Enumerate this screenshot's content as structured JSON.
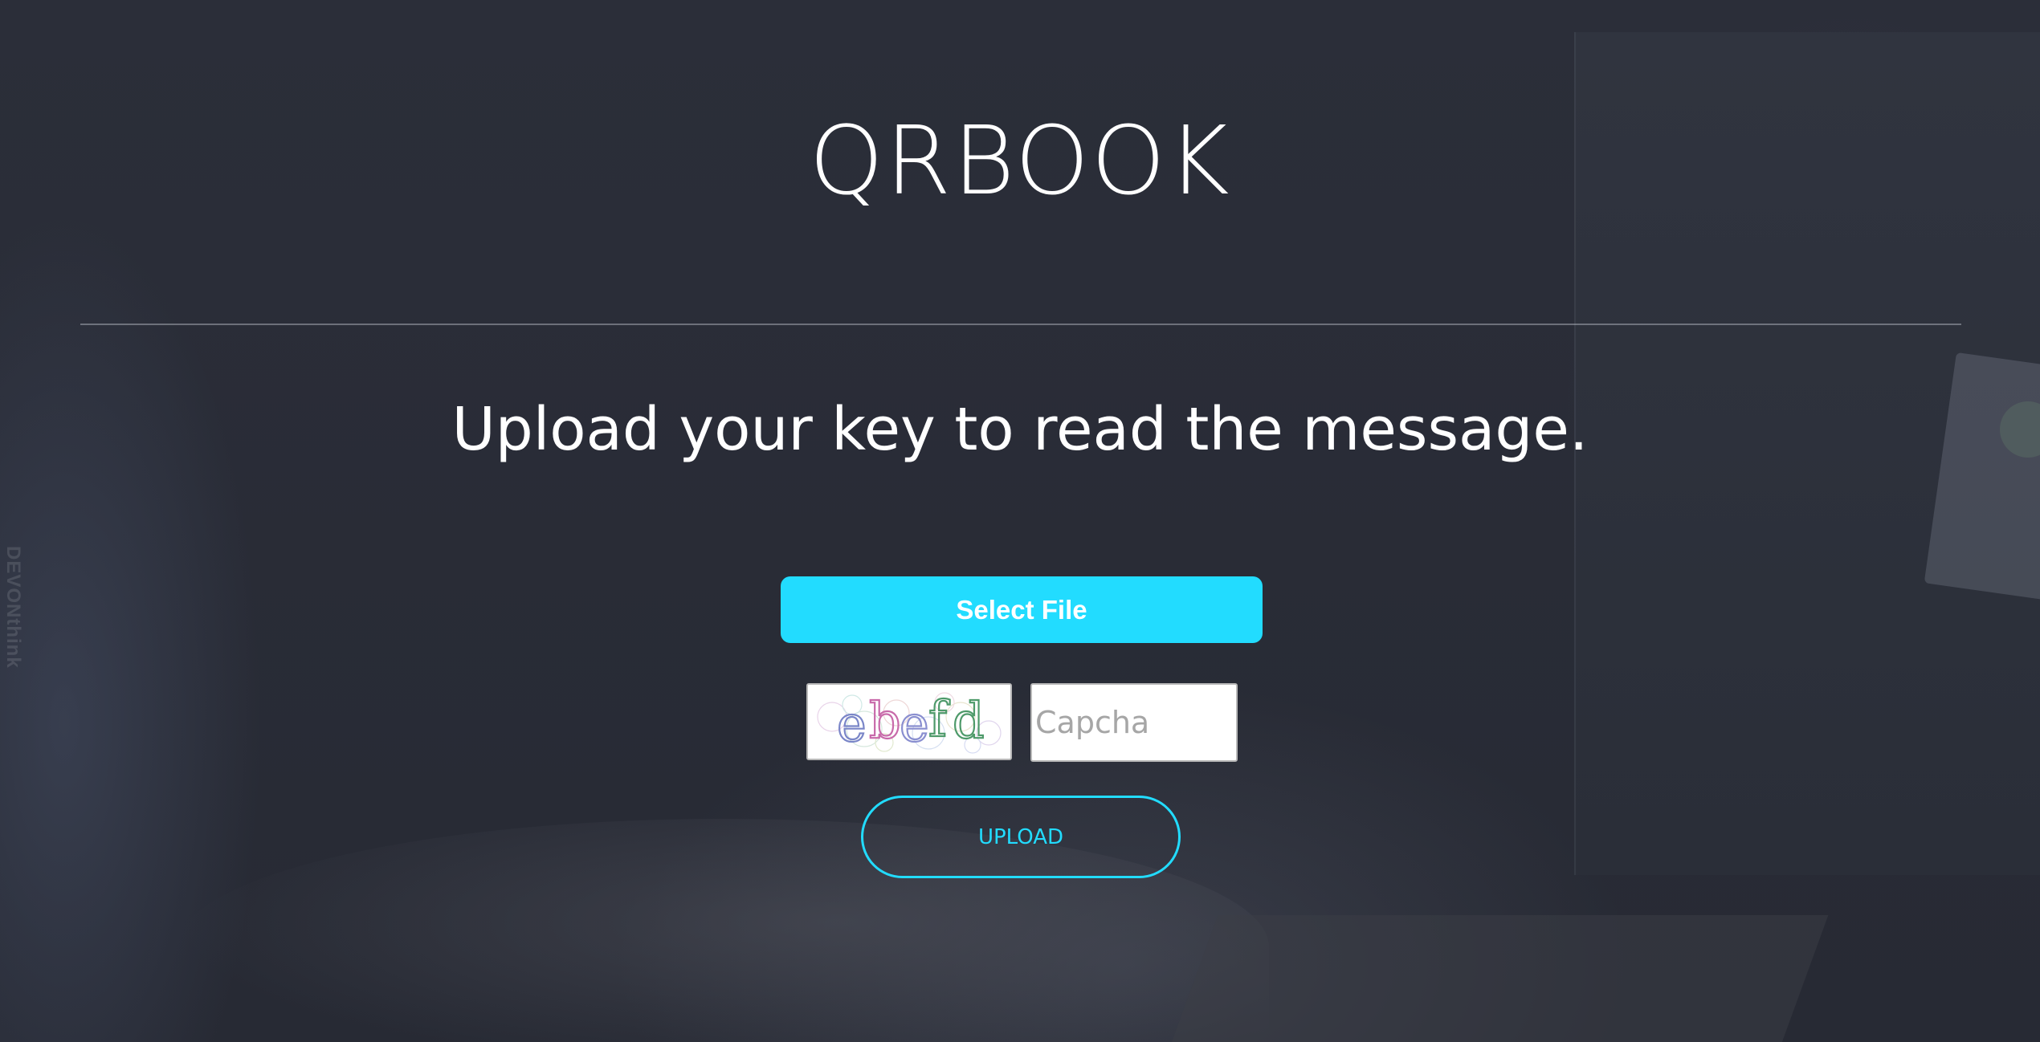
{
  "app": {
    "title": "QRBOOK",
    "subtitle": "Upload your key to read the message."
  },
  "form": {
    "select_file_label": "Select File",
    "captcha_image_text": "ebefd",
    "captcha_placeholder": "Capcha",
    "captcha_value": "",
    "upload_label": "UPLOAD"
  },
  "background": {
    "side_watermark": "DEVONthink"
  },
  "colors": {
    "accent": "#22dcff",
    "background": "#2a2d38",
    "text": "#ffffff"
  }
}
